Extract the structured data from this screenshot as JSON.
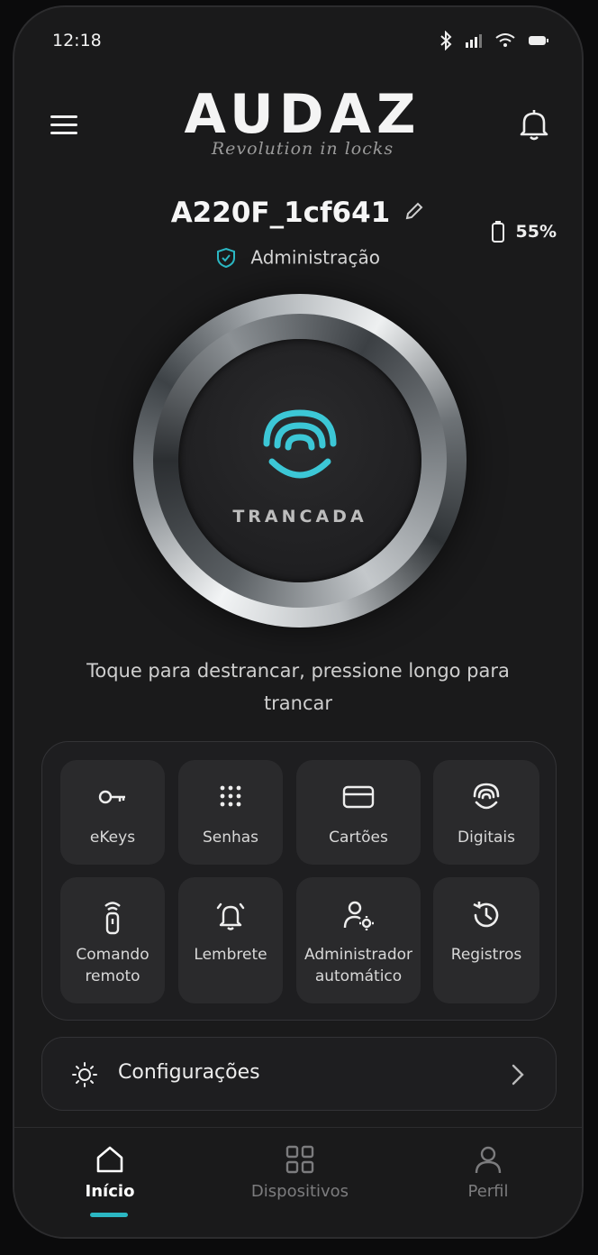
{
  "status_bar": {
    "time": "12:18"
  },
  "header": {
    "brand": "AUDAZ",
    "tagline": "Revolution in locks"
  },
  "device": {
    "name": "A220F_1cf641",
    "role": "Administração",
    "battery": "55%"
  },
  "lock": {
    "state": "TRANCADA",
    "hint": "Toque para destrancar, pressione longo para trancar"
  },
  "features": {
    "items": [
      {
        "label": "eKeys",
        "icon": "key-icon"
      },
      {
        "label": "Senhas",
        "icon": "keypad-icon"
      },
      {
        "label": "Cartões",
        "icon": "card-icon"
      },
      {
        "label": "Digitais",
        "icon": "fingerprint-icon"
      },
      {
        "label": "Comando\nremoto",
        "icon": "remote-icon"
      },
      {
        "label": "Lembrete",
        "icon": "alarm-bell-icon"
      },
      {
        "label": "Administrador\nautomático",
        "icon": "user-gear-icon"
      },
      {
        "label": "Registros",
        "icon": "history-icon"
      }
    ]
  },
  "settings": {
    "label": "Configurações"
  },
  "tabs": [
    {
      "label": "Início",
      "active": true
    },
    {
      "label": "Dispositivos",
      "active": false
    },
    {
      "label": "Perfil",
      "active": false
    }
  ],
  "colors": {
    "accent": "#2bb7c3",
    "background": "#1a1a1b",
    "tile": "#2a2a2c"
  }
}
